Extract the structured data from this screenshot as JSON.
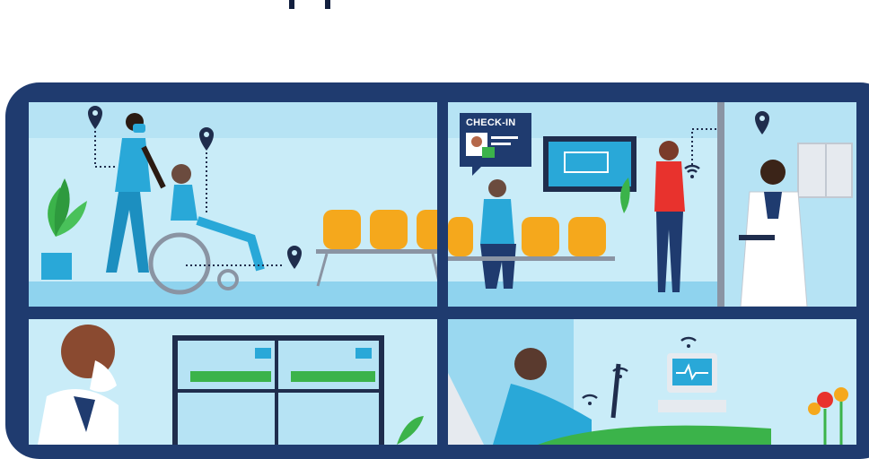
{
  "header": {
    "partial_heading": "pp"
  },
  "scenes": [
    {
      "id": "wheelchair-hallway"
    },
    {
      "id": "waiting-room-checkin",
      "checkin_card": {
        "label": "CHECK-IN"
      }
    },
    {
      "id": "remote-patient-monitoring"
    },
    {
      "id": "patient-bed-telemetry"
    }
  ],
  "colors": {
    "frame": "#1f3b6f",
    "scene_bg": "#c9ecf8",
    "pin": "#1f2d4d",
    "chair": "#f5a81c",
    "scrubs": "#29a8d8",
    "plant": "#3bb34a"
  },
  "icons": [
    "location-pin-icon",
    "wifi-icon",
    "heartbeat-monitor-icon",
    "checkmark-icon"
  ]
}
